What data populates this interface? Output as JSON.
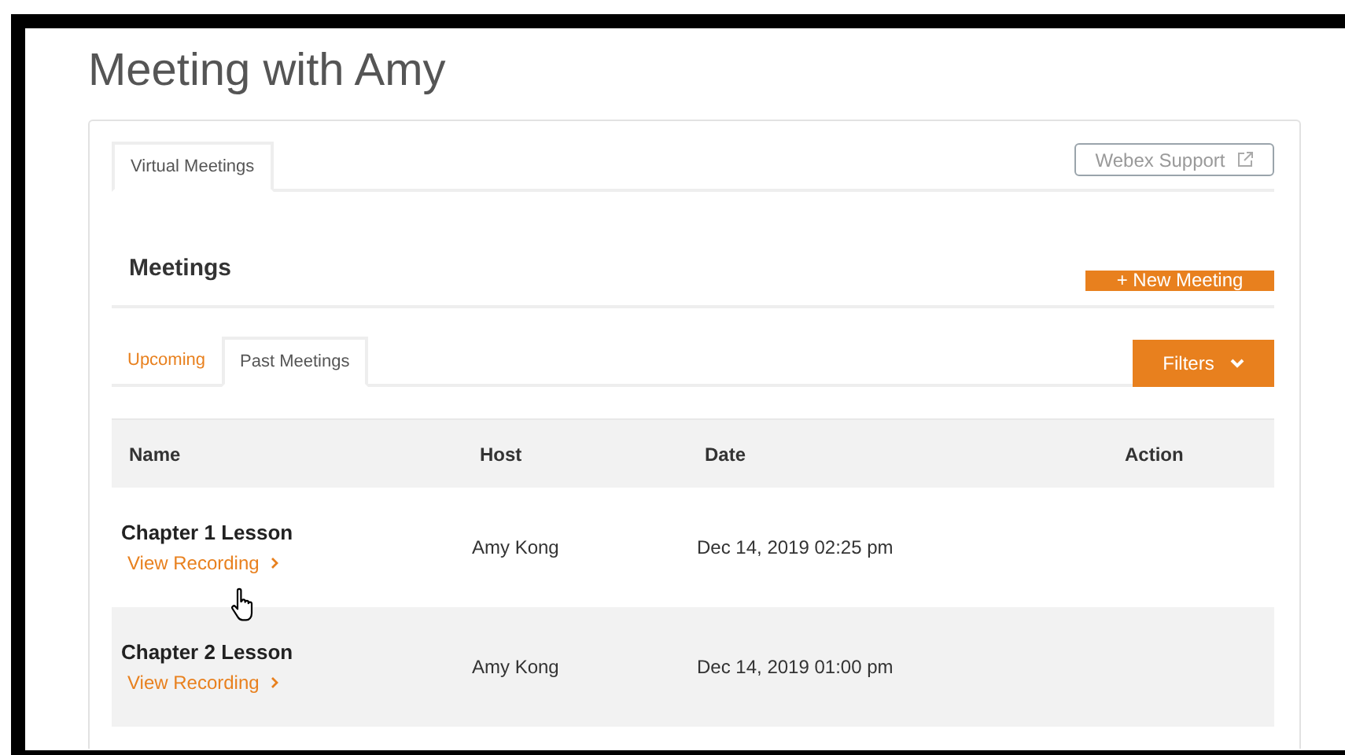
{
  "page": {
    "title": "Meeting with Amy"
  },
  "tabs": [
    {
      "label": "Virtual Meetings",
      "selected": true
    }
  ],
  "support_link": {
    "label": "Webex Support"
  },
  "section": {
    "title": "Meetings",
    "new_button": "+ New Meeting"
  },
  "subtabs": [
    {
      "label": "Upcoming",
      "selected": false
    },
    {
      "label": "Past Meetings",
      "selected": true
    }
  ],
  "filters_button": {
    "label": "Filters"
  },
  "table": {
    "columns": [
      "Name",
      "Host",
      "Date",
      "Action"
    ],
    "rows": [
      {
        "name": "Chapter 1 Lesson",
        "link": "View Recording",
        "host": "Amy Kong",
        "date": "Dec 14, 2019 02:25 pm"
      },
      {
        "name": "Chapter 2 Lesson",
        "link": "View Recording",
        "host": "Amy Kong",
        "date": "Dec 14, 2019 01:00 pm"
      }
    ]
  }
}
